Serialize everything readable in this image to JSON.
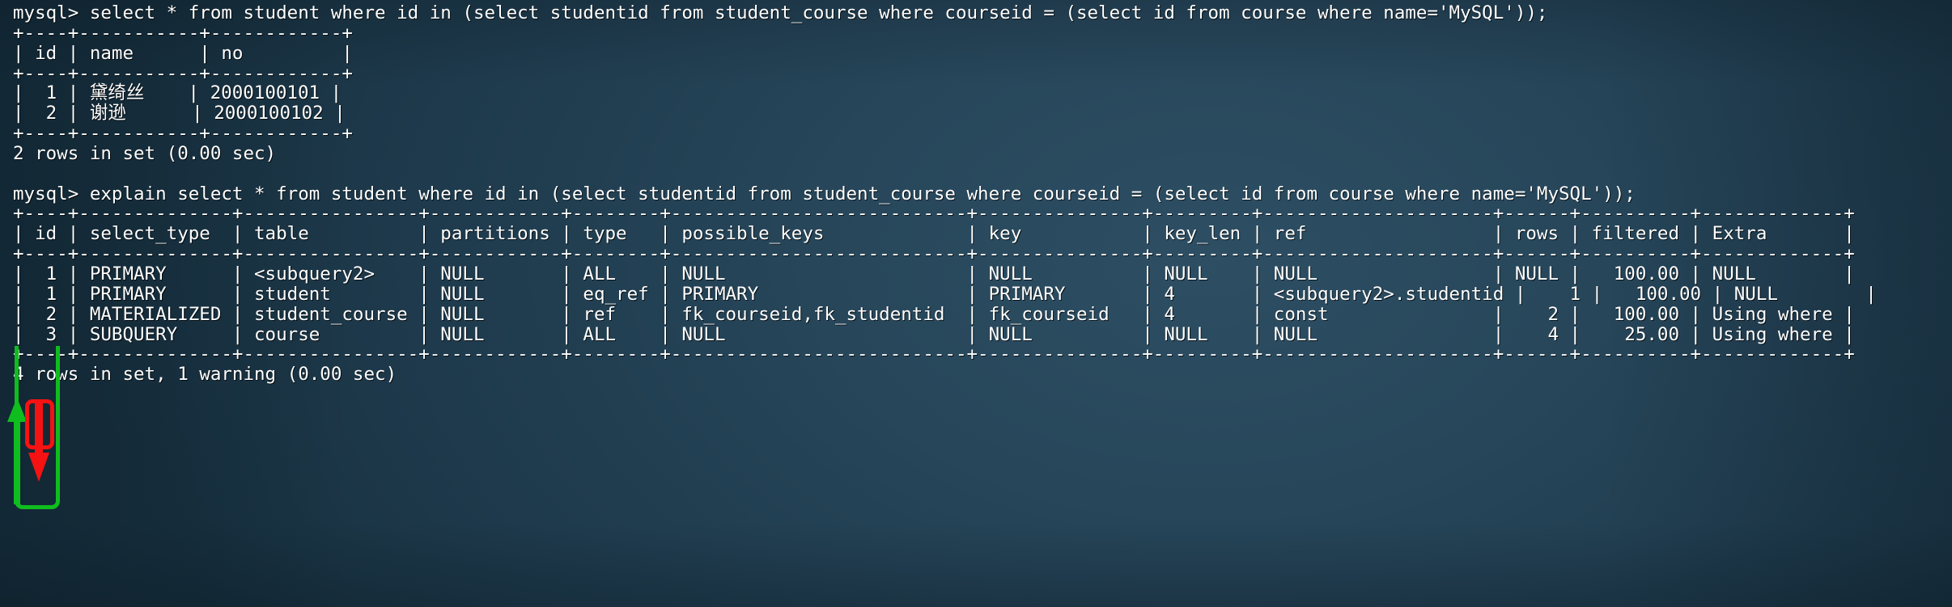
{
  "terminal": {
    "prompt": "mysql>",
    "theme": {
      "background": "#214154",
      "foreground": "#ffffff",
      "green_annotation": "#0fbd1e",
      "red_annotation": "#f51212"
    },
    "lines": [
      "mysql> select * from student where id in (select studentid from student_course where courseid = (select id from course where name='MySQL'));",
      "+----+-----------+------------+",
      "| id | name      | no         |",
      "+----+-----------+------------+",
      "|  1 | 黛绮丝    | 2000100101 |",
      "|  2 | 谢逊      | 2000100102 |",
      "+----+-----------+------------+",
      "2 rows in set (0.00 sec)",
      "",
      "mysql> explain select * from student where id in (select studentid from student_course where courseid = (select id from course where name='MySQL'));",
      "+----+--------------+----------------+------------+--------+---------------------------+---------------+---------+---------------------+------+----------+-------------+",
      "| id | select_type  | table          | partitions | type   | possible_keys             | key           | key_len | ref                 | rows | filtered | Extra       |",
      "+----+--------------+----------------+------------+--------+---------------------------+---------------+---------+---------------------+------+----------+-------------+",
      "|  1 | PRIMARY      | <subquery2>    | NULL       | ALL    | NULL                      | NULL          | NULL    | NULL                | NULL |   100.00 | NULL        |",
      "|  1 | PRIMARY      | student        | NULL       | eq_ref | PRIMARY                   | PRIMARY       | 4       | <subquery2>.studentid |    1 |   100.00 | NULL        |",
      "|  2 | MATERIALIZED | student_course | NULL       | ref    | fk_courseid,fk_studentid  | fk_courseid   | 4       | const               |    2 |   100.00 | Using where |",
      "|  3 | SUBQUERY     | course         | NULL       | ALL    | NULL                      | NULL          | NULL    | NULL                |    4 |    25.00 | Using where |",
      "+----+--------------+----------------+------------+--------+---------------------------+---------------+---------+---------------------+------+----------+-------------+",
      "4 rows in set, 1 warning (0.00 sec)"
    ],
    "queries": {
      "select_query": "select * from student where id in (select studentid from student_course where courseid = (select id from course where name='MySQL'));",
      "explain_query": "explain select * from student where id in (select studentid from student_course where courseid = (select id from course where name='MySQL'));"
    },
    "result_table": {
      "columns": [
        "id",
        "name",
        "no"
      ],
      "rows": [
        [
          "1",
          "黛绮丝",
          "2000100101"
        ],
        [
          "2",
          "谢逊",
          "2000100102"
        ]
      ],
      "status": "2 rows in set (0.00 sec)"
    },
    "explain_table": {
      "columns": [
        "id",
        "select_type",
        "table",
        "partitions",
        "type",
        "possible_keys",
        "key",
        "key_len",
        "ref",
        "rows",
        "filtered",
        "Extra"
      ],
      "rows": [
        [
          "1",
          "PRIMARY",
          "<subquery2>",
          "NULL",
          "ALL",
          "NULL",
          "NULL",
          "NULL",
          "NULL",
          "NULL",
          "100.00",
          "NULL"
        ],
        [
          "1",
          "PRIMARY",
          "student",
          "NULL",
          "eq_ref",
          "PRIMARY",
          "PRIMARY",
          "4",
          "<subquery2>.studentid",
          "1",
          "100.00",
          "NULL"
        ],
        [
          "2",
          "MATERIALIZED",
          "student_course",
          "NULL",
          "ref",
          "fk_courseid,fk_studentid",
          "fk_courseid",
          "4",
          "const",
          "2",
          "100.00",
          "Using where"
        ],
        [
          "3",
          "SUBQUERY",
          "course",
          "NULL",
          "ALL",
          "NULL",
          "NULL",
          "NULL",
          "NULL",
          "4",
          "25.00",
          "Using where"
        ]
      ],
      "status": "4 rows in set, 1 warning (0.00 sec)"
    }
  },
  "annotations": {
    "green_bracket": "id-column-execution-order-bracket",
    "green_arrow": "upward-arrow-execution-order",
    "red_box": "same-id-group-highlight",
    "red_arrow": "downward-arrow-same-id-order"
  }
}
